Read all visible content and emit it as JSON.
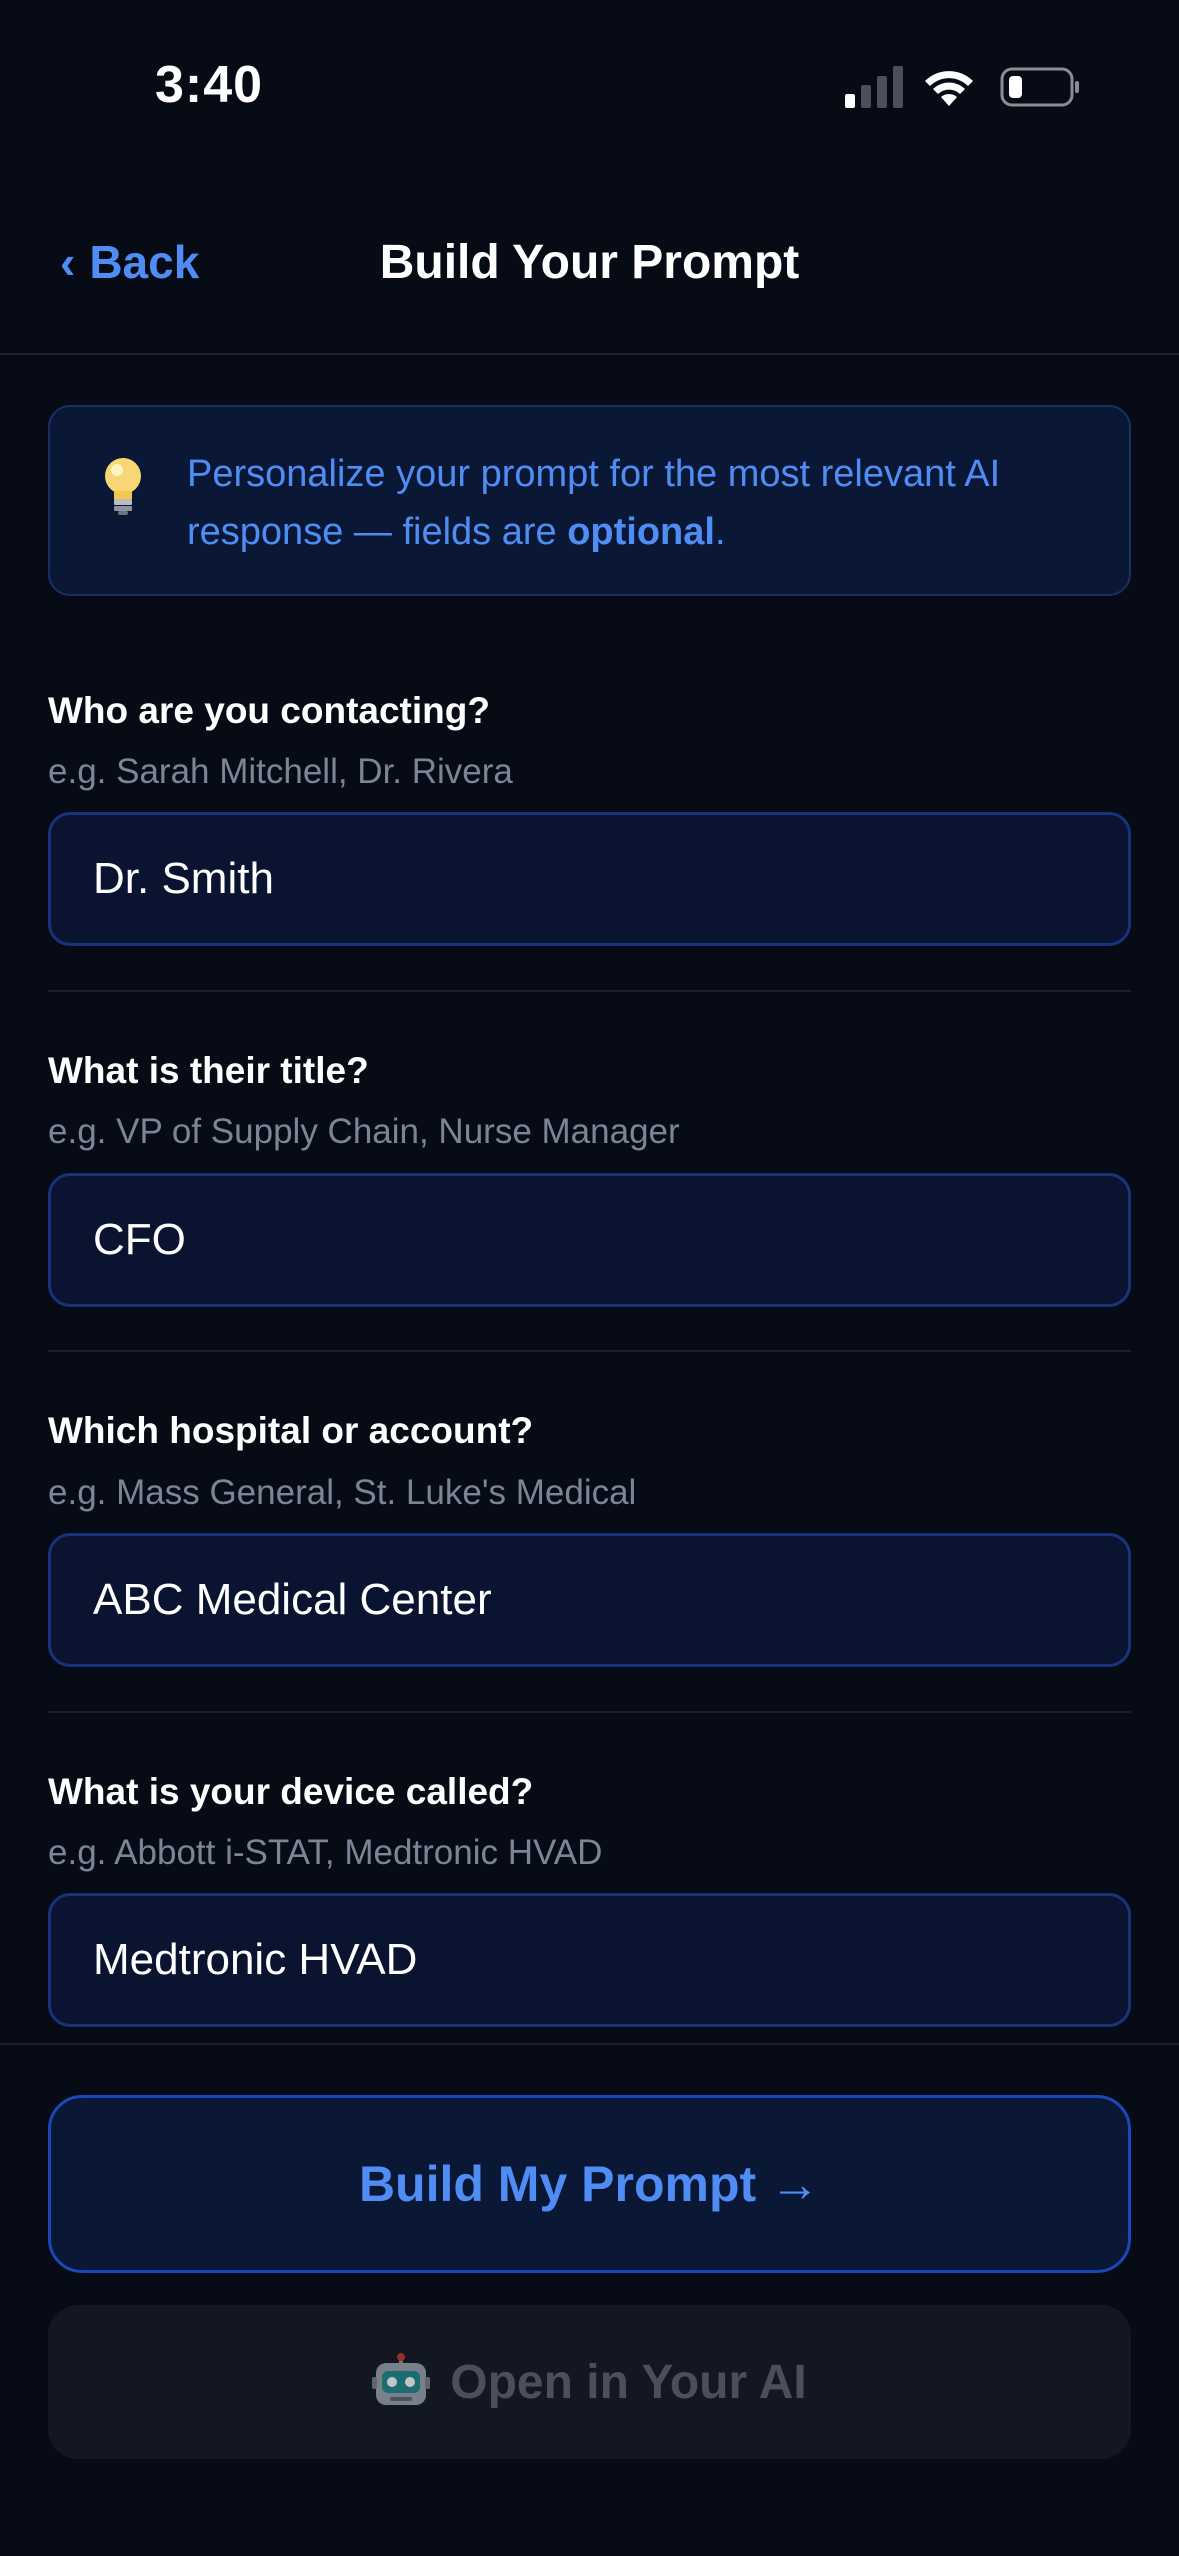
{
  "status_bar": {
    "time": "3:40"
  },
  "nav": {
    "back_label": "Back",
    "title": "Build Your Prompt"
  },
  "banner": {
    "text_prefix": "Personalize your prompt for the most relevant AI response — fields are ",
    "text_bold": "optional",
    "text_suffix": "."
  },
  "fields": [
    {
      "label": "Who are you contacting?",
      "hint": "e.g. Sarah Mitchell, Dr. Rivera",
      "value": "Dr. Smith"
    },
    {
      "label": "What is their title?",
      "hint": "e.g. VP of Supply Chain, Nurse Manager",
      "value": "CFO"
    },
    {
      "label": "Which hospital or account?",
      "hint": "e.g. Mass General, St. Luke's Medical",
      "value": "ABC Medical Center"
    },
    {
      "label": "What is your device called?",
      "hint": "e.g. Abbott i-STAT, Medtronic HVAD",
      "value": "Medtronic HVAD"
    }
  ],
  "actions": {
    "build_label": "Build My Prompt →",
    "open_ai_label": "Open in Your AI"
  },
  "colors": {
    "background": "#070b16",
    "accent": "#4f8df5",
    "input_border": "#17347a",
    "disabled_text": "#4a4f5b"
  }
}
